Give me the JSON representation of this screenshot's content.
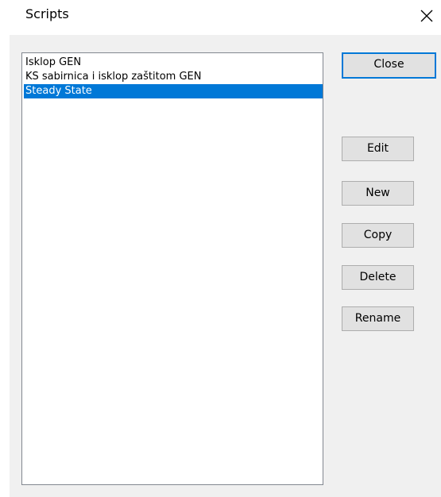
{
  "window": {
    "title": "Scripts",
    "close_glyph": "close-icon"
  },
  "list": {
    "items": [
      {
        "label": "Isklop GEN",
        "selected": false
      },
      {
        "label": "KS sabirnica i isklop zaštitom GEN",
        "selected": false
      },
      {
        "label": "Steady State",
        "selected": true
      }
    ]
  },
  "buttons": {
    "close": "Close",
    "edit": "Edit",
    "new": "New",
    "copy": "Copy",
    "delete": "Delete",
    "rename": "Rename"
  },
  "colors": {
    "selection": "#0078d7",
    "dialog_bg": "#f0f0f0",
    "button_bg": "#e1e1e1"
  }
}
